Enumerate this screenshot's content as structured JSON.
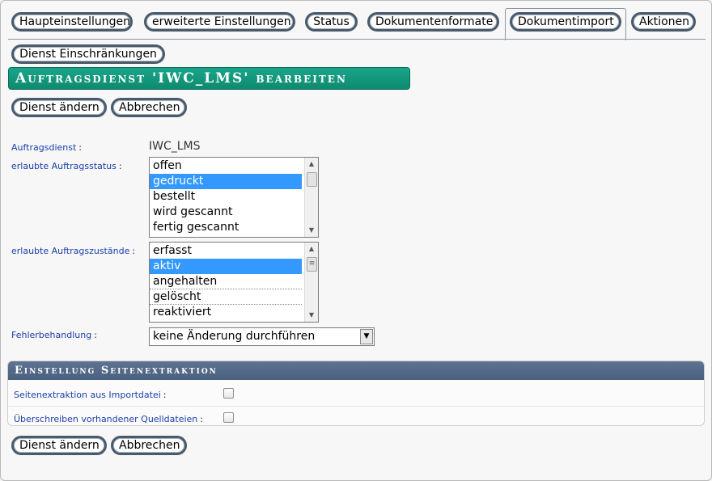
{
  "tabs": [
    {
      "label": "Haupteinstellungen"
    },
    {
      "label": "erweiterte Einstellungen"
    },
    {
      "label": "Status"
    },
    {
      "label": "Dokumentenformate"
    },
    {
      "label": "Dokumentimport"
    },
    {
      "label": "Aktionen"
    },
    {
      "label": "Dienst Einschränkungen"
    }
  ],
  "active_tab": "Dokumentimport",
  "page_title": "Auftragsdienst 'IWC_LMS' bearbeiten",
  "buttons": {
    "change_label": "Dienst ändern",
    "cancel_label": "Abbrechen"
  },
  "form": {
    "service": {
      "label": "Auftragsdienst",
      "colon": ":",
      "value": "IWC_LMS"
    },
    "allowed_status": {
      "label": "erlaubte Auftragsstatus",
      "colon": ":",
      "options": [
        "offen",
        "gedruckt",
        "bestellt",
        "wird gescannt",
        "fertig gescannt"
      ],
      "selected": [
        "gedruckt"
      ]
    },
    "allowed_states": {
      "label": "erlaubte Auftragszustände",
      "colon": ":",
      "options": [
        "erfasst",
        "aktiv",
        "angehalten",
        "gelöscht",
        "reaktiviert"
      ],
      "selected": [
        "aktiv"
      ]
    },
    "error_handling": {
      "label": "Fehlerbehandlung",
      "colon": ":",
      "value": "keine Änderung durchführen"
    }
  },
  "extraction_panel": {
    "title": "Einstellung Seitenextraktion",
    "rows": [
      {
        "label": "Seitenextraktion aus Importdatei",
        "colon": ":",
        "checked": false
      },
      {
        "label": "Überschreiben vorhandener Quelldateien",
        "colon": ":",
        "checked": false
      }
    ]
  },
  "colors": {
    "title_banner": "#139a7e",
    "panel_header": "#526985",
    "label_blue": "#1a3fa8",
    "selection": "#3399ff",
    "button_border": "#485a6c"
  },
  "icons": {
    "scroll_up": "up-arrow-icon",
    "scroll_down": "down-arrow-icon",
    "dropdown": "chevron-down-icon"
  }
}
